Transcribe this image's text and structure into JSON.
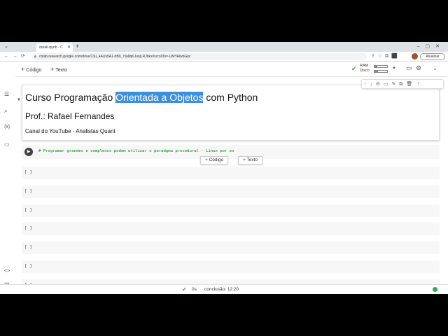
{
  "browser": {
    "tab_title": "durali.ipynb - C",
    "new_tab": "+",
    "url": "colab.research.google.com/drive/13u_4AUs5A1-hB9_YIa8qKJunjLRJhkx#scrollTo=-UMYAlwbGpc",
    "update_label": "Atualizar"
  },
  "toolbar": {
    "add_code": "Código",
    "add_text": "Texto",
    "ram_label": "RAM",
    "disk_label": "Disco",
    "ram_usage": 0.2,
    "disk_usage": 0.25
  },
  "markdown_cell": {
    "title_before": "Curso Programação ",
    "title_highlight": "Orientada a Objetos",
    "title_after": " com Python",
    "subtitle": "Prof.: Rafael Fernandes",
    "channel": "Canal do YouTube - Analistas Quant"
  },
  "code_cell": {
    "code": "# Programar grandes e complexos podem utilizar o paradgma procedural - Linux por ex"
  },
  "insert_buttons": {
    "code": "Código",
    "text": "Texto"
  },
  "empty_cells": [
    "[ ]",
    "[ ]",
    "[ ]",
    "[ ]",
    "[ ]",
    "[ ]",
    "[ ]"
  ],
  "statusbar": {
    "duration": "0s",
    "completion": "conclusão: 12:20"
  },
  "colors": {
    "highlight": "#3a8fde",
    "success": "#34a853",
    "code_comment": "#0b7c0b"
  }
}
